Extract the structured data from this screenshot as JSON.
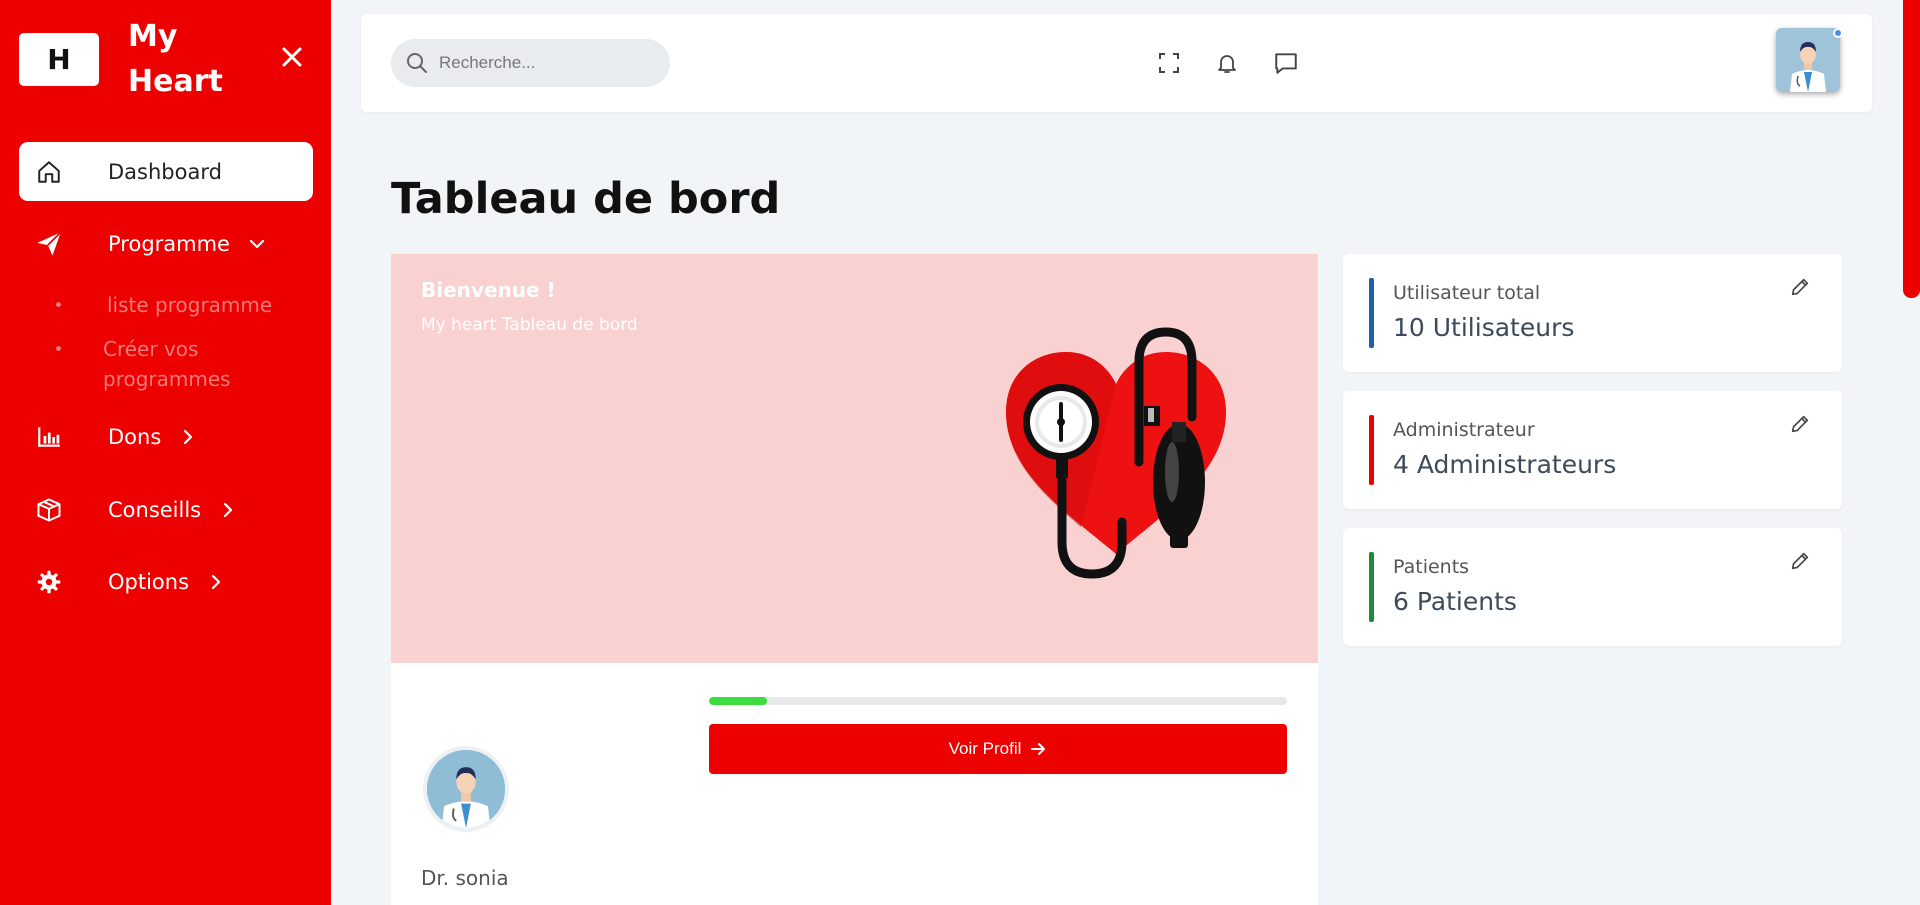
{
  "brand": {
    "logo_letter": "H",
    "name": "My Heart"
  },
  "sidebar": {
    "items": [
      {
        "label": "Dashboard",
        "icon": "home-icon"
      },
      {
        "label": "Programme",
        "icon": "paper-plane-icon"
      },
      {
        "label": "Dons",
        "icon": "bar-chart-icon"
      },
      {
        "label": "Conseills",
        "icon": "box-icon"
      },
      {
        "label": "Options",
        "icon": "gear-icon"
      }
    ],
    "programme_sub": [
      {
        "label": "liste programme"
      },
      {
        "label": "Créer vos programmes"
      }
    ]
  },
  "topbar": {
    "search_placeholder": "Recherche...",
    "icons": [
      "fullscreen-icon",
      "bell-icon",
      "chat-icon"
    ]
  },
  "page": {
    "title": "Tableau de bord"
  },
  "welcome": {
    "title": "Bienvenue !",
    "subtitle": "My heart Tableau de bord"
  },
  "profile": {
    "progress": 0.1,
    "button_label": "Voir Profil",
    "name": "Dr. sonia"
  },
  "stats": [
    {
      "label": "Utilisateur total",
      "value": "10 Utilisateurs",
      "color": "#1f5fa8"
    },
    {
      "label": "Administrateur",
      "value": "4 Administrateurs",
      "color": "#ed0000"
    },
    {
      "label": "Patients",
      "value": "6 Patients",
      "color": "#1e8a3a"
    }
  ],
  "colors": {
    "sidebar": "#ed0000",
    "accent": "#ed0000",
    "welcome_bg": "#fad1d1",
    "progress": "#3ddc3d"
  }
}
